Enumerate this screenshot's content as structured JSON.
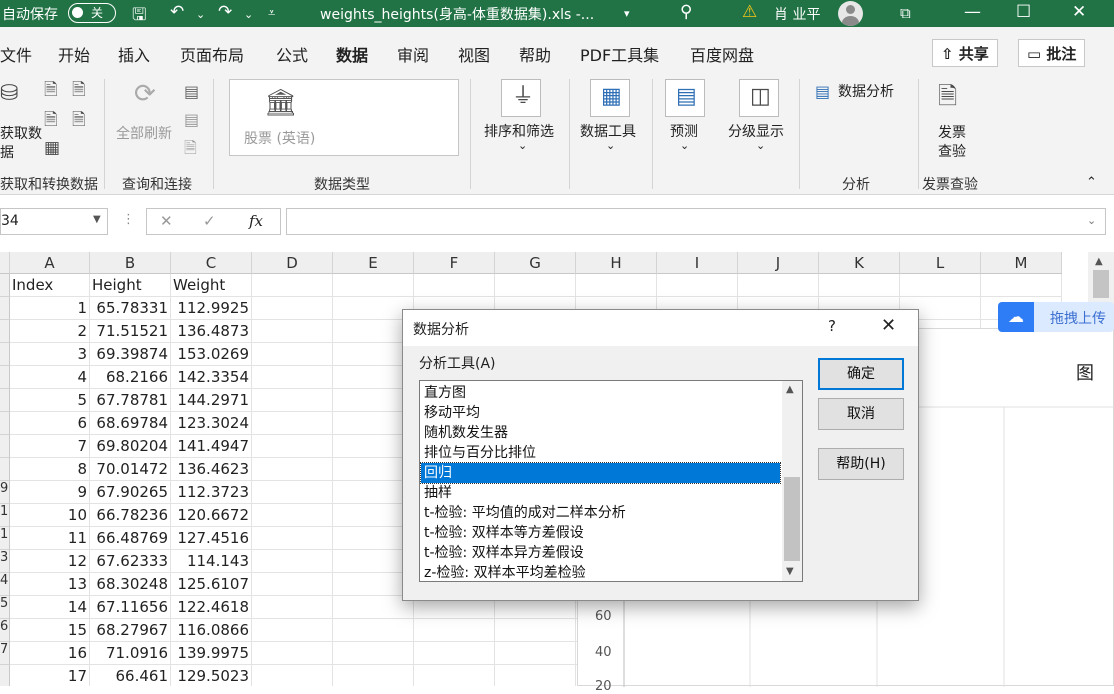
{
  "titlebar": {
    "autosave_label": "自动保存",
    "autosave_state": "关",
    "filename": "weights_heights(身高-体重数据集).xls  -...",
    "user_name": "肖 业平"
  },
  "menu": {
    "items": [
      "文件",
      "开始",
      "插入",
      "页面布局",
      "公式",
      "数据",
      "审阅",
      "视图",
      "帮助",
      "PDF工具集",
      "百度网盘"
    ],
    "active": "数据",
    "share": "共享",
    "comment": "批注"
  },
  "ribbon": {
    "get_data_line1": "获取数",
    "get_data_line2": "据",
    "refresh_all": "全部刷新",
    "stocks": "股票 (英语)",
    "sort_filter": "排序和筛选",
    "data_tools": "数据工具",
    "forecast": "预测",
    "outline": "分级显示",
    "data_analysis": "数据分析",
    "invoice_line1": "发票",
    "invoice_line2": "查验",
    "groups": {
      "get_transform": "获取和转换数据",
      "queries": "查询和连接",
      "data_types": "数据类型",
      "analysis": "分析",
      "invoice": "发票查验"
    }
  },
  "formula_bar": {
    "name_box": "34",
    "fx": "fx",
    "formula": ""
  },
  "sheet": {
    "columns": [
      "A",
      "B",
      "C",
      "D",
      "E",
      "F",
      "G",
      "H",
      "I",
      "J",
      "K",
      "L",
      "M"
    ],
    "headers": [
      "Index",
      "Height",
      "Weight"
    ],
    "row_numbers": [
      "",
      "",
      "",
      "",
      "",
      "",
      "",
      "",
      "9",
      "1",
      "1",
      "3",
      "4",
      "5",
      "6",
      "7",
      ""
    ],
    "rows": [
      {
        "index": "1",
        "height": "65.78331",
        "weight": "112.9925"
      },
      {
        "index": "2",
        "height": "71.51521",
        "weight": "136.4873"
      },
      {
        "index": "3",
        "height": "69.39874",
        "weight": "153.0269"
      },
      {
        "index": "4",
        "height": "68.2166",
        "weight": "142.3354"
      },
      {
        "index": "5",
        "height": "67.78781",
        "weight": "144.2971"
      },
      {
        "index": "6",
        "height": "68.69784",
        "weight": "123.3024"
      },
      {
        "index": "7",
        "height": "69.80204",
        "weight": "141.4947"
      },
      {
        "index": "8",
        "height": "70.01472",
        "weight": "136.4623"
      },
      {
        "index": "9",
        "height": "67.90265",
        "weight": "112.3723"
      },
      {
        "index": "10",
        "height": "66.78236",
        "weight": "120.6672"
      },
      {
        "index": "11",
        "height": "66.48769",
        "weight": "127.4516"
      },
      {
        "index": "12",
        "height": "67.62333",
        "weight": "114.143"
      },
      {
        "index": "13",
        "height": "68.30248",
        "weight": "125.6107"
      },
      {
        "index": "14",
        "height": "67.11656",
        "weight": "122.4618"
      },
      {
        "index": "15",
        "height": "68.27967",
        "weight": "116.0866"
      },
      {
        "index": "16",
        "height": "71.0916",
        "weight": "139.9975"
      },
      {
        "index": "17",
        "height": "66.461",
        "weight": "129.5023"
      }
    ]
  },
  "chart": {
    "title_fragment": "图",
    "y_ticks": [
      "60",
      "40",
      "20"
    ]
  },
  "baidu": {
    "upload_label": "拖拽上传"
  },
  "dialog": {
    "title": "数据分析",
    "help_glyph": "?",
    "close_glyph": "✕",
    "tools_label": "分析工具(A)",
    "tools": [
      "直方图",
      "移动平均",
      "随机数发生器",
      "排位与百分比排位",
      "回归",
      "抽样",
      "t-检验: 平均值的成对二样本分析",
      "t-检验: 双样本等方差假设",
      "t-检验: 双样本异方差假设",
      "z-检验: 双样本平均差检验"
    ],
    "selected_index": 4,
    "ok": "确定",
    "cancel": "取消",
    "help": "帮助(H)"
  },
  "colors": {
    "excel_green": "#217346",
    "selection_blue": "#0078d7"
  }
}
